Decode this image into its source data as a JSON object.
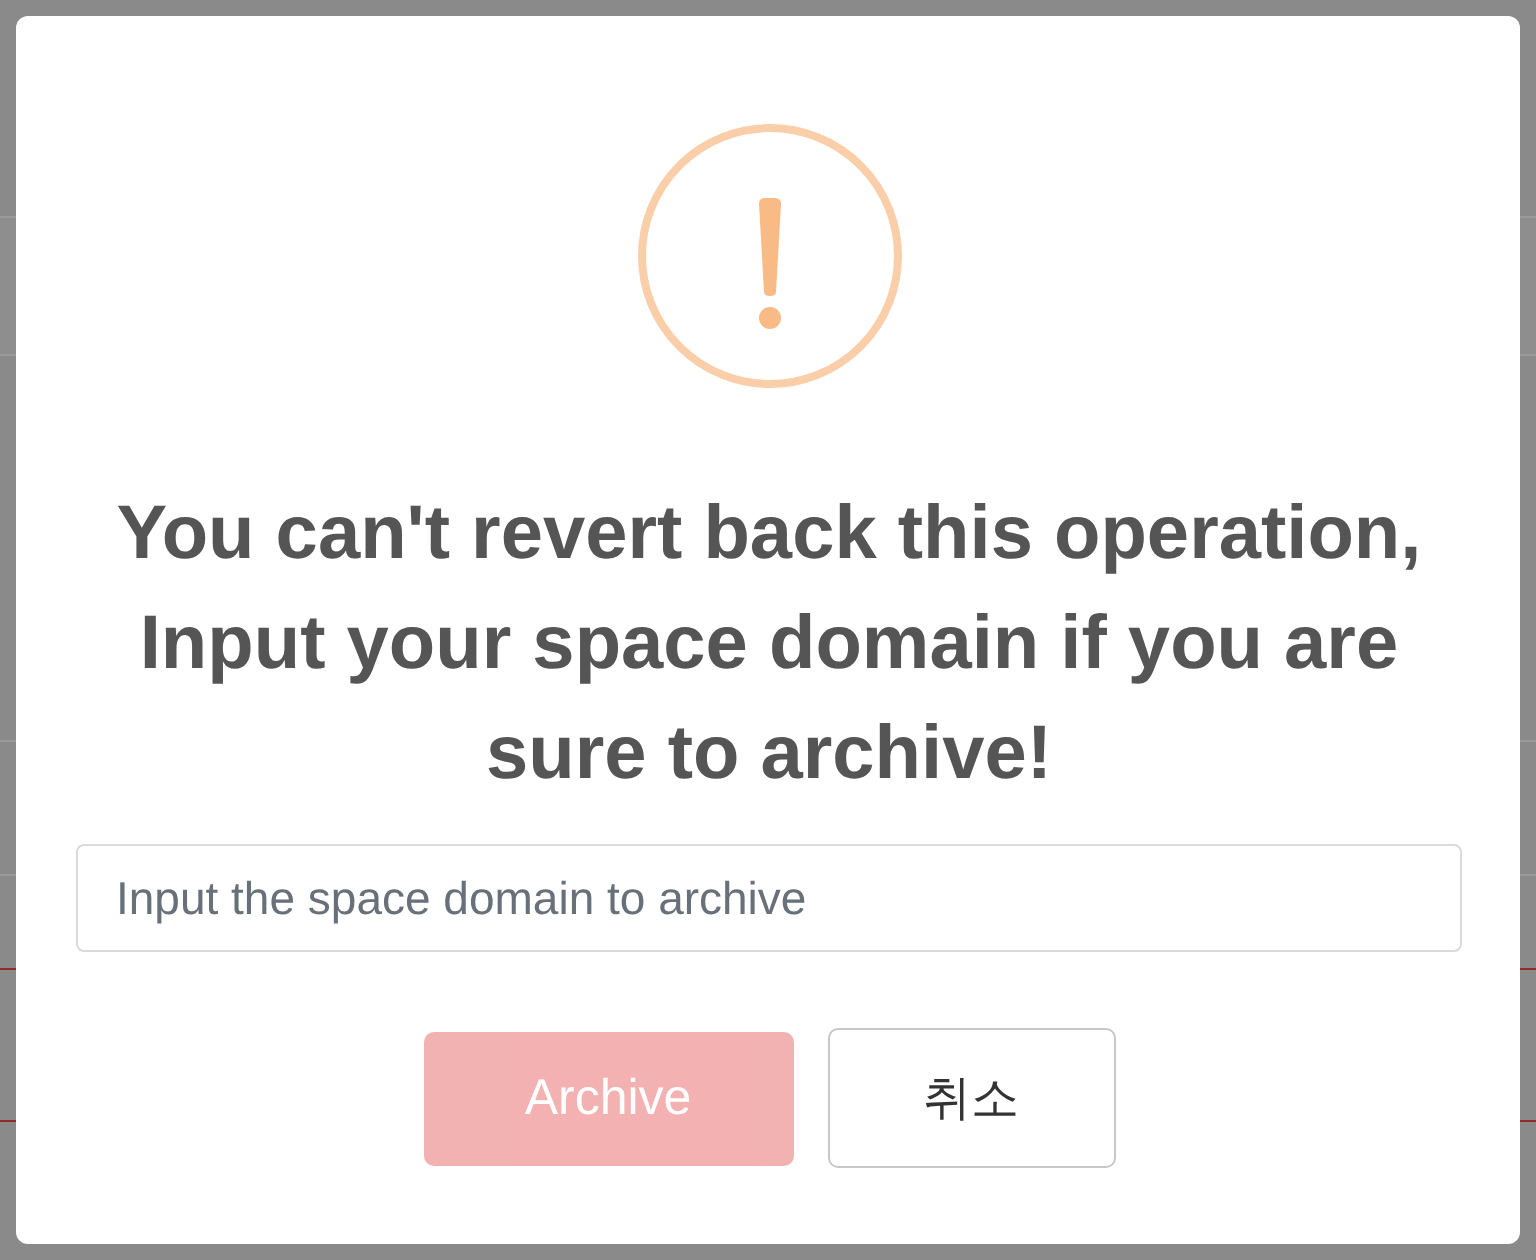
{
  "dialog": {
    "title": "You can't revert back this operation, Input your space domain if you are sure to archive!",
    "input": {
      "placeholder": "Input the space domain to archive"
    },
    "buttons": [
      {
        "label": "Archive",
        "kind": "confirm",
        "disabled": true
      },
      {
        "label": "취소",
        "kind": "cancel",
        "disabled": false
      }
    ]
  }
}
